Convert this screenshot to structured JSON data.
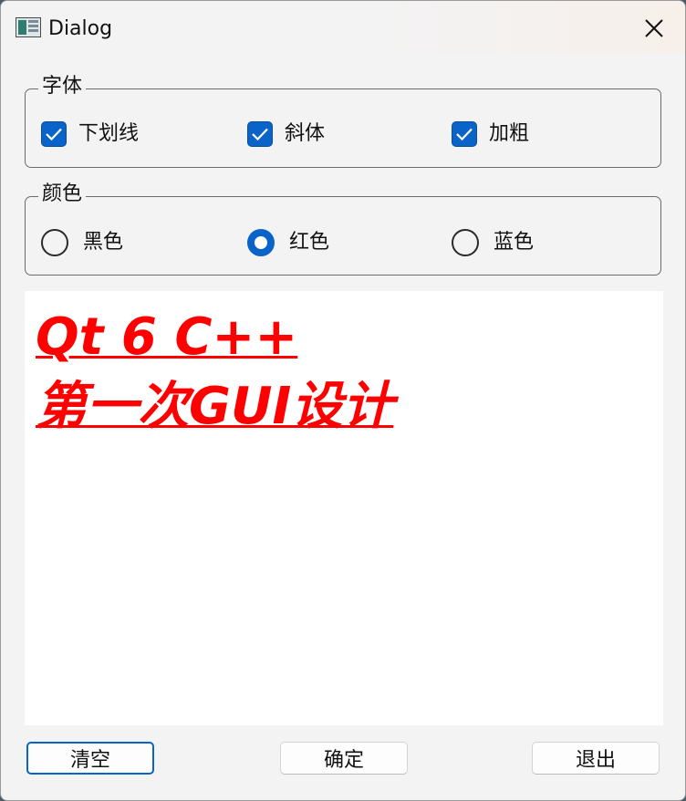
{
  "window": {
    "title": "Dialog",
    "icon": "app-window-icon",
    "close_icon": "close-x-icon"
  },
  "font_group": {
    "title": "字体",
    "options": [
      {
        "label": "下划线",
        "checked": true
      },
      {
        "label": "斜体",
        "checked": true
      },
      {
        "label": "加粗",
        "checked": true
      }
    ]
  },
  "color_group": {
    "title": "颜色",
    "options": [
      {
        "label": "黑色",
        "selected": false
      },
      {
        "label": "红色",
        "selected": true
      },
      {
        "label": "蓝色",
        "selected": false
      }
    ]
  },
  "text_edit": {
    "lines": [
      "Qt 6 C++",
      "第一次GUI设计"
    ],
    "color": "#ff0000",
    "bold": true,
    "italic": true,
    "underline": true
  },
  "buttons": {
    "clear": "清空",
    "ok": "确定",
    "exit": "退出"
  },
  "colors": {
    "accent": "#0a63c9",
    "text": "#ff0000"
  }
}
